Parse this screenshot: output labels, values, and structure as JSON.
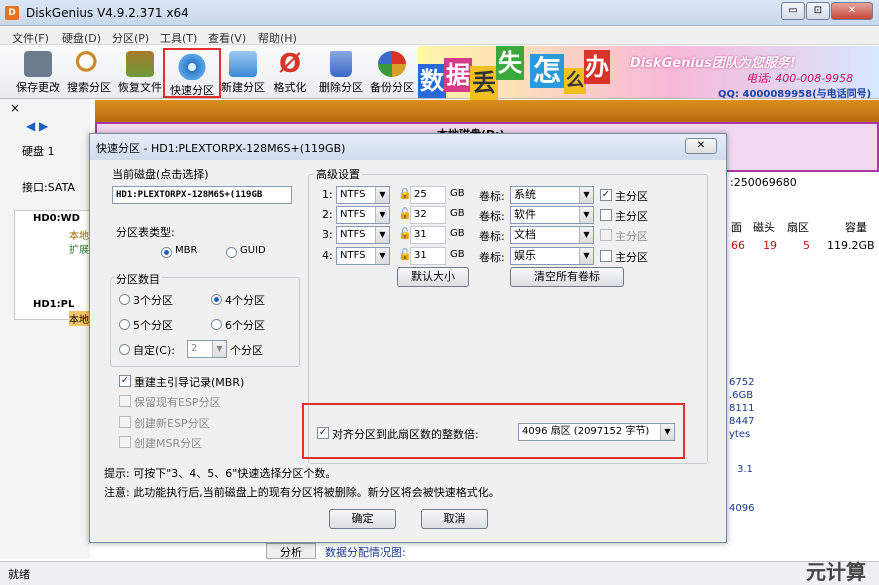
{
  "window": {
    "title": "DiskGenius V4.9.2.371 x64",
    "btn_min": "▭",
    "btn_max": "⊡",
    "btn_close": "✕"
  },
  "menu": [
    "文件(F)",
    "硬盘(D)",
    "分区(P)",
    "工具(T)",
    "查看(V)",
    "帮助(H)"
  ],
  "toolbar": [
    {
      "label": "保存更改",
      "color": "#6b7c8f"
    },
    {
      "label": "搜索分区",
      "color": "#c98a2a"
    },
    {
      "label": "恢复文件",
      "color": "#6b9a3a"
    },
    {
      "label": "快速分区",
      "color": "#2a78c8"
    },
    {
      "label": "新建分区",
      "color": "#3a8ad8"
    },
    {
      "label": "格式化",
      "color": "#d8342a"
    },
    {
      "label": "删除分区",
      "color": "#3a6ac8"
    },
    {
      "label": "备份分区",
      "color": "#d8a02a"
    }
  ],
  "banner": {
    "chars": [
      "数",
      "据",
      "丢",
      "失",
      "怎",
      "么",
      "办"
    ],
    "company": "DiskGenius团队为您服务!",
    "phone": "电话: 400-008-9958",
    "qq": "QQ: 4000089958(与电话同号)"
  },
  "background": {
    "disk_label": "硬盘 1",
    "interface": "接口:SATA",
    "sector_count": ":250069680",
    "tree": [
      "HD0:WD",
      "本地",
      "扩展",
      "HD1:PL",
      "本地"
    ],
    "col_heads": [
      "面",
      "磁头",
      "扇区",
      "容量"
    ],
    "row_vals": [
      "66",
      "19",
      "5",
      "119.2GB"
    ],
    "info_lines": [
      "6752",
      ".6GB",
      "8111",
      "8447",
      "ytes",
      "3.1",
      "4096"
    ],
    "analyze_tab": "分析",
    "analysis_label": "数据分配情况图:",
    "local_disk": "本地磁盘(D:)"
  },
  "status": "就绪",
  "watermark": "元计算",
  "dialog": {
    "title": "快速分区 - HD1:PLEXTORPX-128M6S+(119GB)",
    "close": "✕",
    "current_disk_label": "当前磁盘(点击选择)",
    "current_disk_value": "HD1:PLEXTORPX-128M6S+(119GB",
    "table_type_label": "分区表类型:",
    "table_types": [
      "MBR",
      "GUID"
    ],
    "count_label": "分区数目",
    "count_options": [
      "3个分区",
      "4个分区",
      "5个分区",
      "6个分区"
    ],
    "custom_label": "自定(C):",
    "custom_value": "2",
    "custom_unit": "个分区",
    "rebuild_mbr": "重建主引导记录(MBR)",
    "keep_esp": "保留现有ESP分区",
    "create_esp": "创建新ESP分区",
    "create_msr": "创建MSR分区",
    "advanced_label": "高级设置",
    "partitions": [
      {
        "idx": "1:",
        "fs": "NTFS",
        "size": "25",
        "unit": "GB",
        "vol_label": "卷标:",
        "name": "系统",
        "primary": "主分区",
        "checked": true
      },
      {
        "idx": "2:",
        "fs": "NTFS",
        "size": "32",
        "unit": "GB",
        "vol_label": "卷标:",
        "name": "软件",
        "primary": "主分区",
        "checked": false
      },
      {
        "idx": "3:",
        "fs": "NTFS",
        "size": "31",
        "unit": "GB",
        "vol_label": "卷标:",
        "name": "文档",
        "primary": "主分区",
        "checked": false
      },
      {
        "idx": "4:",
        "fs": "NTFS",
        "size": "31",
        "unit": "GB",
        "vol_label": "卷标:",
        "name": "娱乐",
        "primary": "主分区",
        "checked": false
      }
    ],
    "default_size_btn": "默认大小",
    "clear_labels_btn": "清空所有卷标",
    "align_label": "对齐分区到此扇区数的整数倍:",
    "align_value": "4096 扇区 (2097152 字节)",
    "hint": "提示: 可按下\"3、4、5、6\"快速选择分区个数。",
    "note": "注意: 此功能执行后,当前磁盘上的现有分区将被删除。新分区将会被快速格式化。",
    "ok": "确定",
    "cancel": "取消"
  }
}
